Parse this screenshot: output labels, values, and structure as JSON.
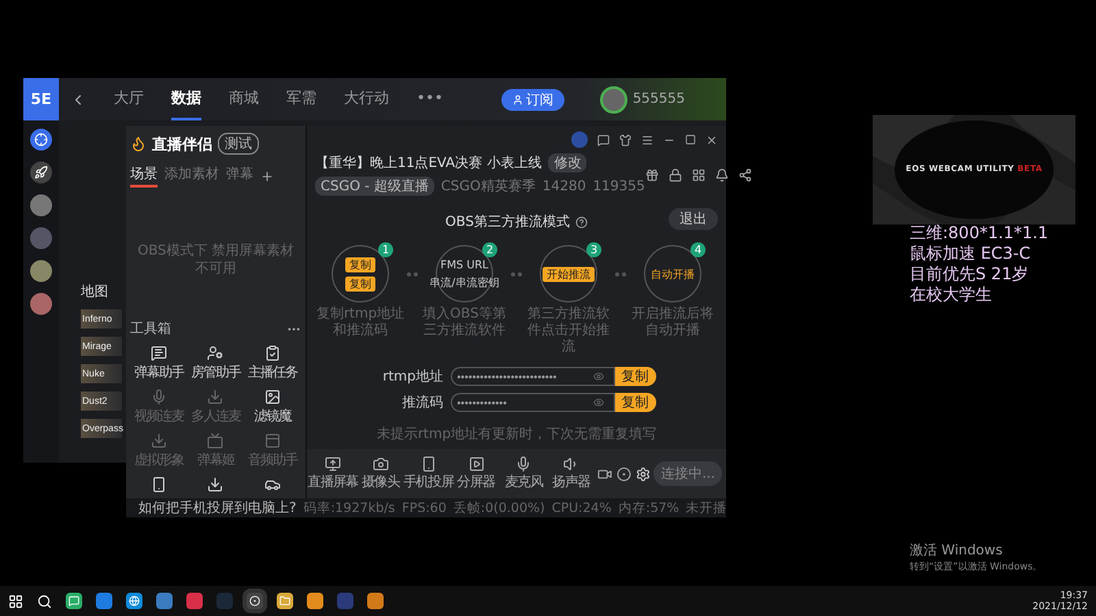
{
  "back_window": {
    "logo": "5E",
    "nav": [
      {
        "label": "大厅",
        "selected": false
      },
      {
        "label": "数据",
        "selected": true
      },
      {
        "label": "商城",
        "selected": false
      },
      {
        "label": "军需",
        "selected": false
      },
      {
        "label": "大行动",
        "selected": false
      }
    ],
    "more": "•••",
    "subscribe": "订阅",
    "user": "555555",
    "map_tab": "地图",
    "maps": [
      "Inferno",
      "Mirage",
      "Nuke",
      "Dust2",
      "Overpass"
    ]
  },
  "live_window": {
    "app_name": "直播伴侣",
    "beta": "测试",
    "scene_tabs": [
      {
        "label": "场景",
        "selected": true
      },
      {
        "label": "添加素材",
        "selected": false
      },
      {
        "label": "弹幕",
        "selected": false
      }
    ],
    "empty_hint": "OBS模式下 禁用屏幕素材不可用",
    "tools_title": "工具箱",
    "tools": [
      {
        "label": "弹幕助手",
        "disabled": false
      },
      {
        "label": "房管助手",
        "disabled": false
      },
      {
        "label": "主播任务",
        "disabled": false
      },
      {
        "label": "视频连麦",
        "disabled": true
      },
      {
        "label": "多人连麦",
        "disabled": true
      },
      {
        "label": "滤镜魔",
        "disabled": false
      },
      {
        "label": "虚拟形象",
        "disabled": true
      },
      {
        "label": "弹幕姬",
        "disabled": true
      },
      {
        "label": "音频助手",
        "disabled": true
      }
    ],
    "banner": "如何把手机投屏到电脑上?",
    "title": "【重华】晚上11点EVA决赛 小表上线",
    "edit": "修改",
    "category": "CSGO - 超级直播",
    "season": "CSGO精英赛季",
    "count_a": "14280",
    "count_b": "119355",
    "mode_title": "OBS第三方推流模式",
    "exit": "退出",
    "steps": [
      {
        "number": "1",
        "caption": "复制rtmp地址和推流码",
        "content": [
          {
            "kind": "button",
            "label": "复制"
          },
          {
            "kind": "button",
            "label": "复制"
          }
        ]
      },
      {
        "number": "2",
        "caption": "填入OBS等第三方推流软件",
        "content": [
          {
            "kind": "text",
            "label": "FMS URL"
          },
          {
            "kind": "text",
            "label": "串流/串流密钥"
          }
        ]
      },
      {
        "number": "3",
        "caption": "第三方推流软件点击开始推流",
        "content": [
          {
            "kind": "button",
            "label": "开始推流"
          }
        ]
      },
      {
        "number": "4",
        "caption": "开启推流后将自动开播",
        "content": [
          {
            "kind": "highlight",
            "label": "自动开播"
          }
        ]
      }
    ],
    "fields": [
      {
        "label": "rtmp地址",
        "value": "••••••••••••••••••••••••••",
        "copy": "复制"
      },
      {
        "label": "推流码",
        "value": "•••••••••••••",
        "copy": "复制"
      }
    ],
    "note": "未提示rtmp地址有更新时，下次无需重复填写",
    "toolbar": [
      "直播屏幕",
      "摄像头",
      "手机投屏",
      "分屏器",
      "麦克风",
      "扬声器"
    ],
    "connect": "连接中...",
    "status": [
      "码率:1927kb/s",
      "FPS:60",
      "丢帧:0(0.00%)",
      "CPU:24%",
      "内存:57%",
      "未开播"
    ]
  },
  "webcam": {
    "label": "EOS WEBCAM UTILITY",
    "tag": "BETA"
  },
  "overlay_lines": [
    "三维:800*1.1*1.1",
    "鼠标加速 EC3-C",
    "目前优先S 21岁",
    "在校大学生"
  ],
  "activation": {
    "title": "激活 Windows",
    "hint": "转到“设置”以激活 Windows。"
  },
  "clock": {
    "time": "19:37",
    "date": "2021/12/12"
  }
}
